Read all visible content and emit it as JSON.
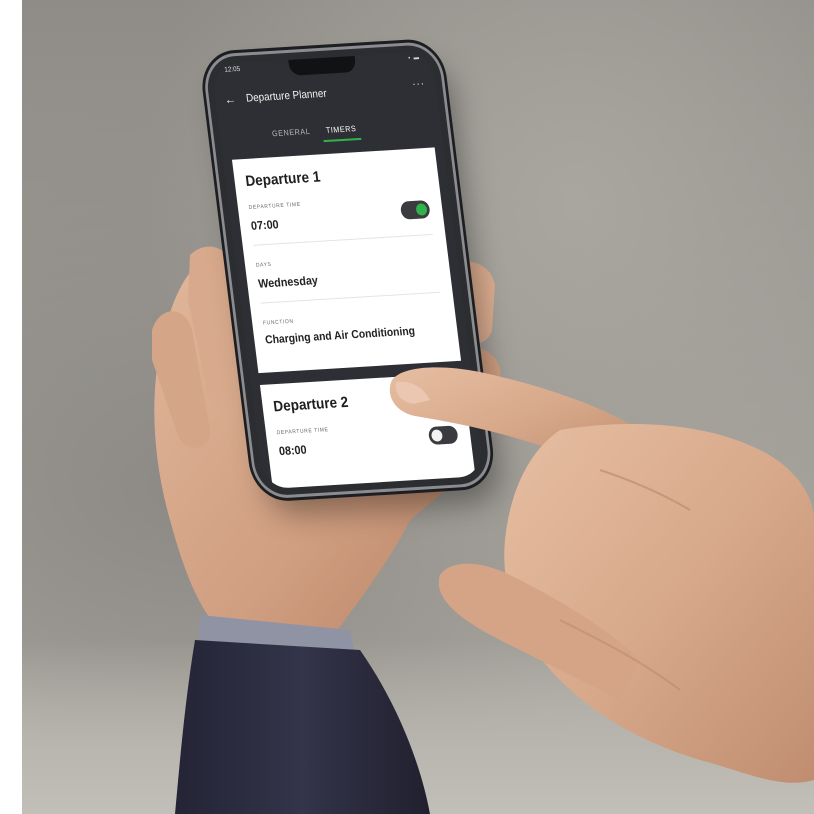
{
  "app": {
    "title": "Departure Planner",
    "status_time": "12:05",
    "tabs": [
      {
        "label": "GENERAL"
      },
      {
        "label": "TIMERS"
      }
    ]
  },
  "departures": [
    {
      "title": "Departure 1",
      "time_label": "DEPARTURE TIME",
      "time": "07:00",
      "enabled": true,
      "days_label": "DAYS",
      "days": "Wednesday",
      "function_label": "FUNCTION",
      "function": "Charging and Air Conditioning"
    },
    {
      "title": "Departure 2",
      "time_label": "DEPARTURE TIME",
      "time": "08:00",
      "enabled": false
    }
  ],
  "colors": {
    "accent": "#2fb34a",
    "app_background": "#2e2f34",
    "card": "#ffffff"
  },
  "icons": {
    "back": "back-arrow-icon",
    "more": "more-options-icon"
  }
}
